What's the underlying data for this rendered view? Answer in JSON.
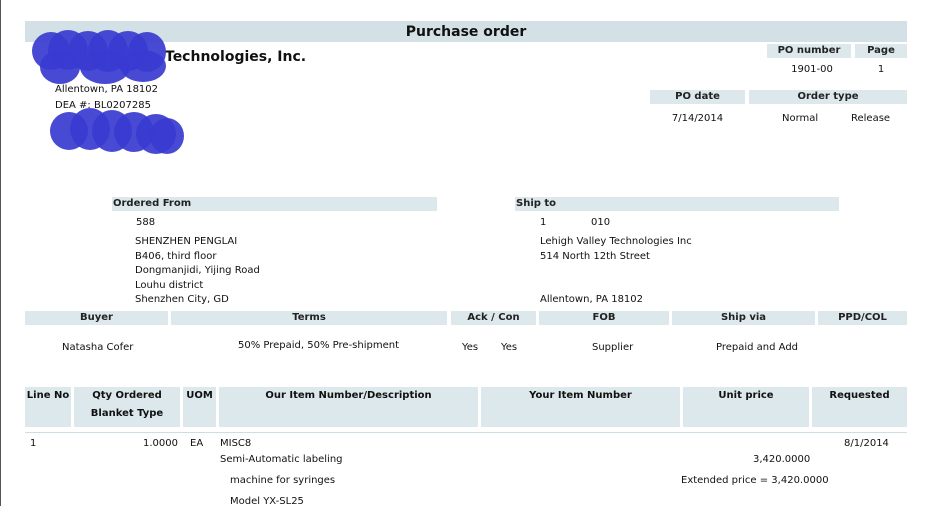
{
  "title": "Purchase order",
  "company": {
    "name_visible": "Technologies, Inc.",
    "address_line": "Allentown, PA 18102",
    "dea_line": "DEA #: BL0207285"
  },
  "po_box": {
    "po_number_label": "PO number",
    "page_label": "Page",
    "po_number": "1901-00",
    "page": "1",
    "po_date_label": "PO date",
    "order_type_label": "Order type",
    "po_date": "7/14/2014",
    "order_type": "Normal",
    "release": "Release"
  },
  "ordered_from": {
    "label": "Ordered From",
    "code": "588",
    "lines": [
      "SHENZHEN PENGLAI",
      "B406, third floor",
      "Dongmanjidi, Yijing Road",
      "Louhu district",
      "Shenzhen City, GD"
    ]
  },
  "ship_to": {
    "label": "Ship to",
    "code": "1",
    "code2": "010",
    "lines": [
      "Lehigh Valley Technologies Inc",
      "514 North 12th Street",
      "Allentown, PA 18102"
    ]
  },
  "terms_table": {
    "headers": {
      "buyer": "Buyer",
      "terms": "Terms",
      "ack": "Ack / Con",
      "fob": "FOB",
      "ship_via": "Ship via",
      "ppd": "PPD/COL"
    },
    "row": {
      "buyer": "Natasha Cofer",
      "terms": "50% Prepaid, 50% Pre-shipment",
      "ack": "Yes",
      "con": "Yes",
      "fob": "Supplier",
      "ship_via": "Prepaid and Add",
      "ppd": ""
    }
  },
  "items_table": {
    "headers": {
      "line_no": "Line No",
      "qty": "Qty Ordered",
      "blanket": "Blanket Type",
      "uom": "UOM",
      "description": "Our Item Number/Description",
      "your_item": "Your Item Number",
      "unit_price": "Unit price",
      "requested": "Requested"
    },
    "rows": [
      {
        "line_no": "1",
        "qty": "1.0000",
        "uom": "EA",
        "item": "MISC8",
        "desc1": "Semi-Automatic labeling",
        "desc2": "machine for syringes",
        "desc3": "Model YX-SL25",
        "unit_price": "3,420.0000",
        "extended": "Extended price = 3,420.0000",
        "requested": "8/1/2014"
      }
    ]
  }
}
